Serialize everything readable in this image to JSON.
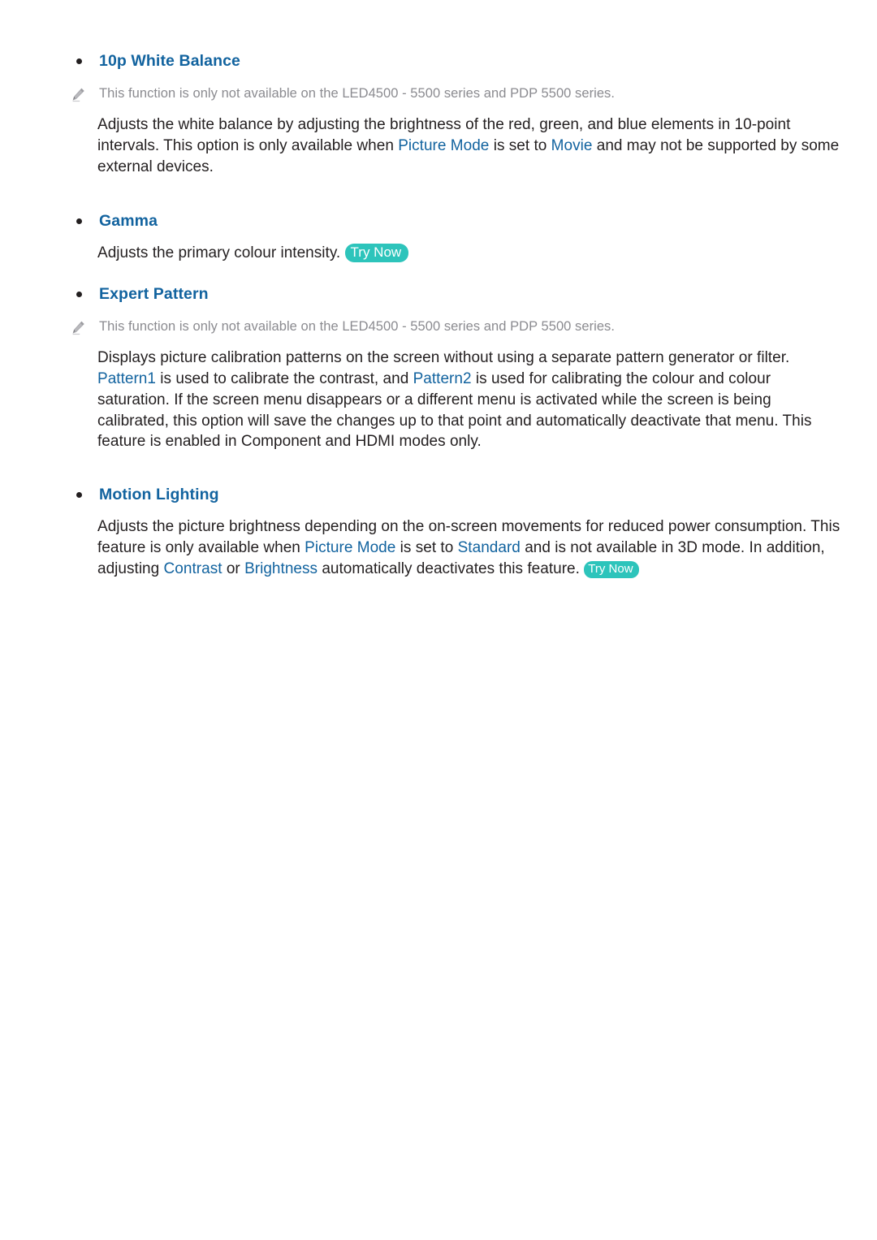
{
  "document": {
    "type": "e-manual-page",
    "accent_blue": "#12639f",
    "body_text_color": "#231f20",
    "note_text_color": "#8b8b90",
    "badge_color": "#2dc4bb",
    "badge_text_color": "#ffffff"
  },
  "sections": [
    {
      "id": "white-balance-10p",
      "bullet": "•",
      "title": "10p White Balance",
      "note": {
        "icon": "pencil-icon",
        "text": "This function is only not available on the LED4500 - 5500 series and PDP 5500 series."
      },
      "body": {
        "part1": "Adjusts the white balance by adjusting the brightness of the red, green, and blue elements in 10-point intervals. This option is only available when ",
        "hl1": "Picture Mode",
        "part2": " is set to ",
        "hl2": "Movie",
        "part3": " and may not be supported by some external devices."
      }
    },
    {
      "id": "gamma",
      "bullet": "•",
      "title": "Gamma",
      "body": {
        "part1": "Adjusts the primary colour intensity. "
      },
      "badge": "Try Now"
    },
    {
      "id": "expert-pattern",
      "bullet": "•",
      "title": "Expert Pattern",
      "note": {
        "icon": "pencil-icon",
        "text": "This function is only not available on the LED4500 - 5500 series and PDP 5500 series."
      },
      "body": {
        "part1": "Displays picture calibration patterns on the screen without using a separate pattern generator or filter. ",
        "hl1": "Pattern1",
        "part2": " is used to calibrate the contrast, and ",
        "hl2": "Pattern2",
        "part3": " is used for calibrating the colour and colour saturation. If the screen menu disappears or a different menu is activated while the screen is being calibrated, this option will save the changes up to that point and automatically deactivate that menu. This feature is enabled in Component and HDMI modes only."
      }
    },
    {
      "id": "motion-lighting",
      "bullet": "•",
      "title": "Motion Lighting",
      "body": {
        "part1": "Adjusts the picture brightness depending on the on-screen movements for reduced power consumption. This feature is only available when ",
        "hl1": "Picture Mode",
        "part2": " is set to ",
        "hl2": "Standard",
        "part3": " and is not available in 3D mode. In addition, adjusting ",
        "hl3": "Contrast",
        "part4": " or ",
        "hl4": "Brightness",
        "part5": " automatically deactivates this feature. "
      },
      "badge": "Try Now"
    }
  ]
}
